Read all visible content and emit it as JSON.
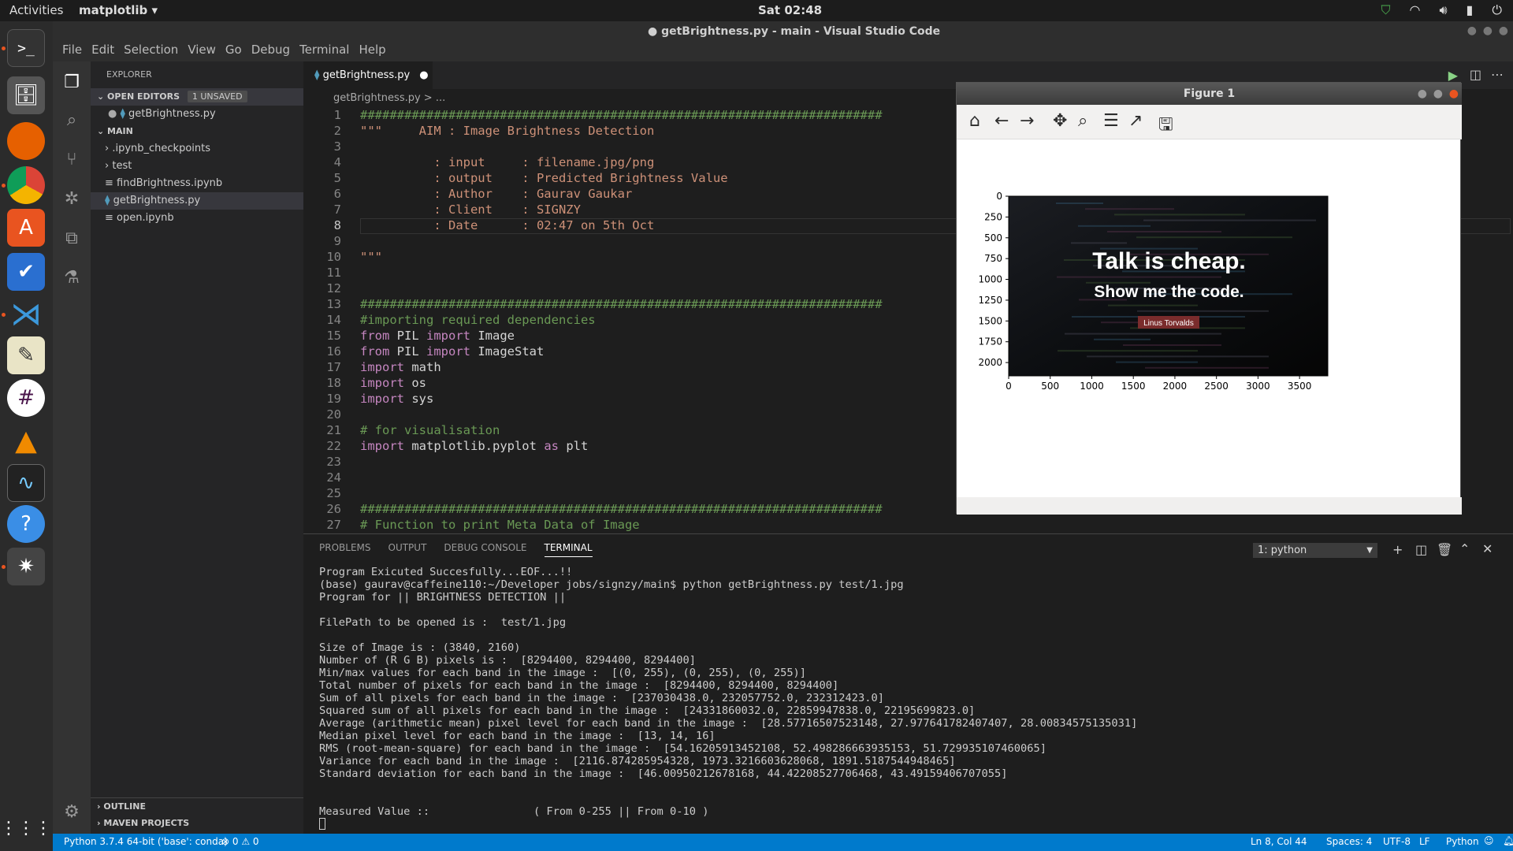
{
  "topbar": {
    "activities": "Activities",
    "app": "matplotlib ▾",
    "clock": "Sat 02:48"
  },
  "window": {
    "title": "● getBrightness.py - main - Visual Studio Code"
  },
  "menu": [
    "File",
    "Edit",
    "Selection",
    "View",
    "Go",
    "Debug",
    "Terminal",
    "Help"
  ],
  "explorer": {
    "header": "EXPLORER",
    "open_editors": "OPEN EDITORS",
    "unsaved": "1 UNSAVED",
    "open_file": "getBrightness.py",
    "folder": "MAIN",
    "items": [
      ".ipynb_checkpoints",
      "test",
      "findBrightness.ipynb",
      "getBrightness.py",
      "open.ipynb"
    ],
    "outline": "OUTLINE",
    "maven": "MAVEN PROJECTS"
  },
  "tab": {
    "label": "getBrightness.py"
  },
  "breadcrumb": "getBrightness.py > ...",
  "code_lines": [
    "#######################################################################",
    "\"\"\"     AIM : Image Brightness Detection",
    "",
    "          : input     : filename.jpg/png",
    "          : output    : Predicted Brightness Value",
    "          : Author    : Gaurav Gaukar",
    "          : Client    : SIGNZY",
    "          : Date      : 02:47 on 5th Oct",
    "",
    "\"\"\"",
    "",
    "",
    "#######################################################################",
    "#importing required dependencies",
    "from PIL import Image",
    "from PIL import ImageStat",
    "import math",
    "import os",
    "import sys",
    "",
    "# for visualisation",
    "import matplotlib.pyplot as plt",
    "",
    "",
    "",
    "#######################################################################",
    "# Function to print Meta Data of Image"
  ],
  "panel": {
    "tabs": [
      "PROBLEMS",
      "OUTPUT",
      "DEBUG CONSOLE",
      "TERMINAL"
    ],
    "select": "1: python"
  },
  "terminal": [
    "Program Exicuted Succesfully...EOF...!!",
    "(base) gaurav@caffeine110:~/Developer jobs/signzy/main$ python getBrightness.py test/1.jpg",
    "Program for || BRIGHTNESS DETECTION ||",
    "",
    "FilePath to be opened is :  test/1.jpg",
    "",
    "Size of Image is : (3840, 2160)",
    "Number of (R G B) pixels is :  [8294400, 8294400, 8294400]",
    "Min/max values for each band in the image :  [(0, 255), (0, 255), (0, 255)]",
    "Total number of pixels for each band in the image :  [8294400, 8294400, 8294400]",
    "Sum of all pixels for each band in the image :  [237030438.0, 232057752.0, 232312423.0]",
    "Squared sum of all pixels for each band in the image :  [24331860032.0, 22859947838.0, 22195699823.0]",
    "Average (arithmetic mean) pixel level for each band in the image :  [28.57716507523148, 27.977641782407407, 28.00834575135031]",
    "Median pixel level for each band in the image :  [13, 14, 16]",
    "RMS (root-mean-square) for each band in the image :  [54.16205913452108, 52.498286663935153, 51.729935107460065]",
    "Variance for each band in the image :  [2116.874285954328, 1973.3216603628068, 1891.5187544948465]",
    "Standard deviation for each band in the image :  [46.00950212678168, 44.42208527706468, 43.49159406707055]",
    "",
    "",
    "Measured Value ::                ( From 0-255 || From 0-10 )"
  ],
  "status": {
    "python": "Python 3.7.4 64-bit ('base': conda)",
    "problems": "⊗ 0 ⚠ 0",
    "pos": "Ln 8, Col 44",
    "spaces": "Spaces: 4",
    "enc": "UTF-8",
    "eol": "LF",
    "lang": "Python"
  },
  "figure": {
    "title": "Figure 1",
    "overlay_title": "Talk is cheap.",
    "overlay_sub": "Show me the code.",
    "overlay_name": "Linus Torvalds"
  },
  "chart_data": {
    "type": "image",
    "xlim": [
      0,
      3840
    ],
    "ylim": [
      2160,
      0
    ],
    "x_ticks": [
      0,
      500,
      1000,
      1500,
      2000,
      2500,
      3000,
      3500
    ],
    "y_ticks": [
      0,
      250,
      500,
      750,
      1000,
      1250,
      1500,
      1750,
      2000
    ]
  }
}
